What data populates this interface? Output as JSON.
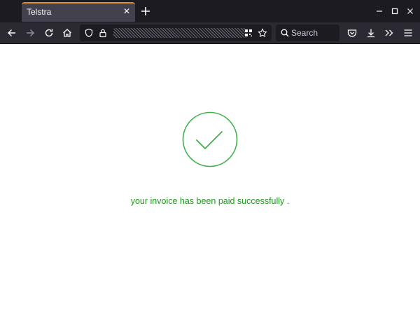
{
  "browser": {
    "tab": {
      "title": "Telstra",
      "close_glyph": "✕"
    },
    "new_tab_icon": "plus-icon",
    "window_controls": [
      "minimize-icon",
      "maximize-icon",
      "close-icon"
    ],
    "nav_icons": [
      "back-arrow-icon",
      "forward-arrow-icon",
      "reload-icon",
      "home-icon"
    ],
    "urlbar_icons": [
      "shield-icon",
      "lock-icon",
      "qr-code-icon",
      "bookmark-star-icon"
    ],
    "search": {
      "placeholder": "Search",
      "icon": "search-icon"
    },
    "toolbar_right_icons": [
      "pocket-icon",
      "download-icon",
      "overflow-chevron-icon",
      "hamburger-menu-icon"
    ],
    "tab_accent_color": "#e08d36"
  },
  "page": {
    "status_icon": "checkmark-circle-icon",
    "status_color": "#1e9a1e",
    "message": "your invoice has been paid successfully ."
  }
}
